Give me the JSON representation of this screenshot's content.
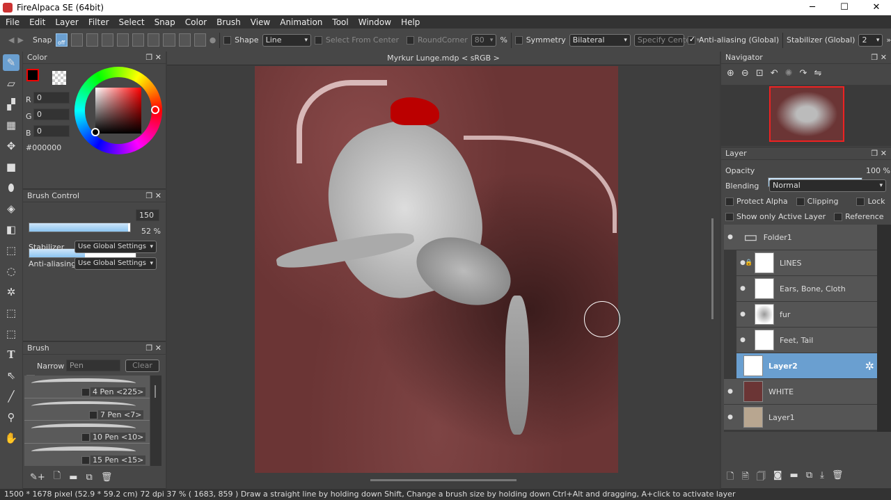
{
  "app": {
    "title": "FireAlpaca SE (64bit)"
  },
  "window_controls": {
    "minimize": "─",
    "maximize": "☐",
    "close": "✕"
  },
  "menu": [
    "File",
    "Edit",
    "Layer",
    "Filter",
    "Select",
    "Snap",
    "Color",
    "Brush",
    "View",
    "Animation",
    "Tool",
    "Window",
    "Help"
  ],
  "toolbar": {
    "snap_label": "Snap",
    "snap_off": "off",
    "shape_label": "Shape",
    "shape_value": "Line",
    "select_from_center": "Select From Center",
    "round_corner": "RoundCorner",
    "round_corner_value": "80",
    "percent": "%",
    "symmetry": "Symmetry",
    "symmetry_value": "Bilateral",
    "specify_center": "Specify Center",
    "antialias": "Anti-aliasing (Global)",
    "stabilizer": "Stabilizer (Global)",
    "stabilizer_value": "2",
    "more": "»"
  },
  "color_panel": {
    "title": "Color",
    "r_label": "R",
    "r": "0",
    "g_label": "G",
    "g": "0",
    "b_label": "B",
    "b": "0",
    "hex": "#000000",
    "primary": "#000000",
    "secondary": "#ffffff"
  },
  "brush_control": {
    "title": "Brush Control",
    "size": "150",
    "size_fraction": 0.98,
    "opacity": "52 %",
    "opacity_fraction": 0.52,
    "stabilizer_label": "Stabilizer",
    "stabilizer_value": "Use Global Settings",
    "antialias_label": "Anti-aliasing",
    "antialias_value": "Use Global Settings"
  },
  "brush_panel": {
    "title": "Brush",
    "narrow": "Narrow",
    "filter": "Pen",
    "clear": "Clear",
    "brushes": [
      "4 Pen <225>",
      "7 Pen <7>",
      "10 Pen <10>",
      "15 Pen <15>"
    ]
  },
  "canvas": {
    "tab": "Myrkur Lunge.mdp < sRGB >"
  },
  "navigator": {
    "title": "Navigator"
  },
  "layer_panel": {
    "title": "Layer",
    "opacity_label": "Opacity",
    "opacity": "100 %",
    "opacity_fraction": 1.0,
    "blending_label": "Blending",
    "blending": "Normal",
    "protect_alpha": "Protect Alpha",
    "clipping": "Clipping",
    "lock": "Lock",
    "show_only_active": "Show only Active Layer",
    "reference": "Reference",
    "layers": [
      {
        "name": "Folder1",
        "type": "folder"
      },
      {
        "name": "LINES",
        "indent": true,
        "locked": true
      },
      {
        "name": "Ears, Bone, Cloth",
        "indent": true
      },
      {
        "name": "fur",
        "indent": true
      },
      {
        "name": "Feet, Tail",
        "indent": true
      },
      {
        "name": "Layer2",
        "active": true
      },
      {
        "name": "WHITE"
      },
      {
        "name": "Layer1"
      }
    ]
  },
  "status": {
    "text": "1500 * 1678 pixel  (52.9 * 59.2 cm)  72 dpi  37 %  ( 1683, 859 )  Draw a straight line by holding down Shift, Change a brush size by holding down Ctrl+Alt and dragging, A+click to activate layer"
  },
  "colors": {
    "accent": "#6a9fd0",
    "canvas_bg": "#6b3535"
  }
}
